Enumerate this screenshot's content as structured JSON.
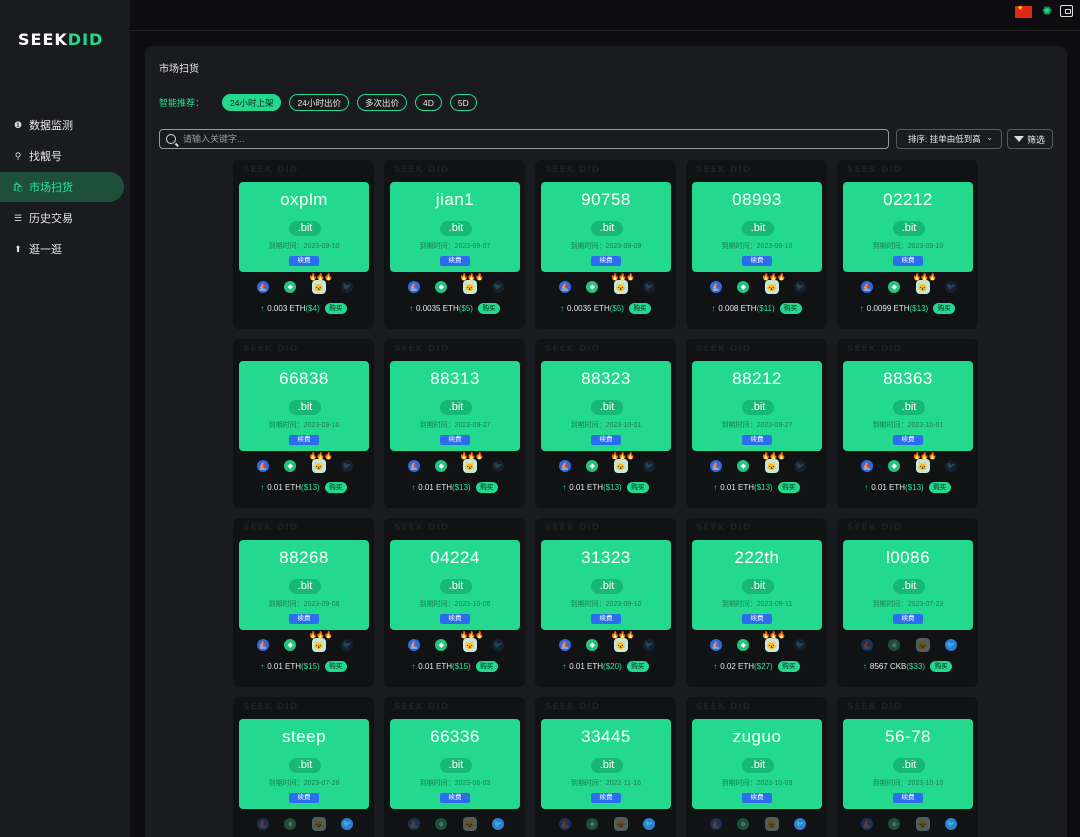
{
  "brand": {
    "logo_part1": "SEEK",
    "logo_part2": "DID"
  },
  "sidebar": {
    "items": [
      {
        "label": "数据监测",
        "icon": "info-icon",
        "glyph": "❶",
        "active": false
      },
      {
        "label": "找靓号",
        "icon": "search-icon",
        "glyph": "⚲",
        "active": false
      },
      {
        "label": "市场扫货",
        "icon": "shopping-bag-icon",
        "glyph": "🛍",
        "active": true
      },
      {
        "label": "历史交易",
        "icon": "list-icon",
        "glyph": "☰",
        "active": false
      },
      {
        "label": "逛一逛",
        "icon": "rocket-icon",
        "glyph": "⬆",
        "active": false
      }
    ]
  },
  "topbar": {
    "language": "zh-CN",
    "flag_icon": "china-flag-icon",
    "theme_icon": "sun-icon",
    "wallet_icon": "wallet-icon"
  },
  "main": {
    "title": "市场扫货",
    "filters": {
      "label": "智能推荐：",
      "chips": [
        {
          "label": "24小时上架",
          "active": true
        },
        {
          "label": "24小时出价",
          "active": false
        },
        {
          "label": "多次出价",
          "active": false
        },
        {
          "label": "4D",
          "active": false
        },
        {
          "label": "5D",
          "active": false
        }
      ]
    },
    "search": {
      "placeholder": "请输入关键字..."
    },
    "sort": {
      "label": "排序: 挂单由低到高"
    },
    "filter_button": {
      "label": "筛选"
    }
  },
  "card_text": {
    "watermark": "SEEK DID",
    "tld": ".bit",
    "expire_label": "到期时间：",
    "renew": "续费",
    "buy": "购买"
  },
  "colors": {
    "accent": "#22d98d",
    "renew_blue": "#2c6df0",
    "bg": "#0d0d0f",
    "panel": "#1a1b1e"
  },
  "cards": [
    {
      "name": "oxplm",
      "expire": "2023-09-10",
      "price": "0.003 ETH",
      "usd": "($4)",
      "style": "eth"
    },
    {
      "name": "jian1",
      "expire": "2023-09-07",
      "price": "0.0035 ETH",
      "usd": "($5)",
      "style": "eth"
    },
    {
      "name": "90758",
      "expire": "2023-09-09",
      "price": "0.0035 ETH",
      "usd": "($5)",
      "style": "eth"
    },
    {
      "name": "08993",
      "expire": "2023-09-10",
      "price": "0.008 ETH",
      "usd": "($11)",
      "style": "eth"
    },
    {
      "name": "02212",
      "expire": "2023-09-10",
      "price": "0.0099 ETH",
      "usd": "($13)",
      "style": "eth"
    },
    {
      "name": "66838",
      "expire": "2023-09-10",
      "price": "0.01 ETH",
      "usd": "($13)",
      "style": "eth"
    },
    {
      "name": "88313",
      "expire": "2023-09-27",
      "price": "0.01 ETH",
      "usd": "($13)",
      "style": "eth"
    },
    {
      "name": "88323",
      "expire": "2023-10-01",
      "price": "0.01 ETH",
      "usd": "($13)",
      "style": "eth"
    },
    {
      "name": "88212",
      "expire": "2023-09-27",
      "price": "0.01 ETH",
      "usd": "($13)",
      "style": "eth"
    },
    {
      "name": "88363",
      "expire": "2023-10-01",
      "price": "0.01 ETH",
      "usd": "($13)",
      "style": "eth"
    },
    {
      "name": "88268",
      "expire": "2023-09-08",
      "price": "0.01 ETH",
      "usd": "($15)",
      "style": "eth"
    },
    {
      "name": "04224",
      "expire": "2023-10-06",
      "price": "0.01 ETH",
      "usd": "($15)",
      "style": "eth"
    },
    {
      "name": "31323",
      "expire": "2023-09-10",
      "price": "0.01 ETH",
      "usd": "($20)",
      "style": "eth"
    },
    {
      "name": "222th",
      "expire": "2023-09-11",
      "price": "0.02 ETH",
      "usd": "($27)",
      "style": "eth"
    },
    {
      "name": "l0086",
      "expire": "2023-07-23",
      "price": "8567 CKB",
      "usd": "($33)",
      "style": "ckb"
    },
    {
      "name": "steep",
      "expire": "2023-07-28",
      "price": "",
      "usd": "",
      "style": "ckb"
    },
    {
      "name": "66336",
      "expire": "2023-06-03",
      "price": "",
      "usd": "",
      "style": "ckb"
    },
    {
      "name": "33445",
      "expire": "2022-11-16",
      "price": "",
      "usd": "",
      "style": "ckb"
    },
    {
      "name": "zuguo",
      "expire": "2023-10-03",
      "price": "",
      "usd": "",
      "style": "ckb"
    },
    {
      "name": "56-78",
      "expire": "2023-10-10",
      "price": "",
      "usd": "",
      "style": "ckb"
    }
  ]
}
